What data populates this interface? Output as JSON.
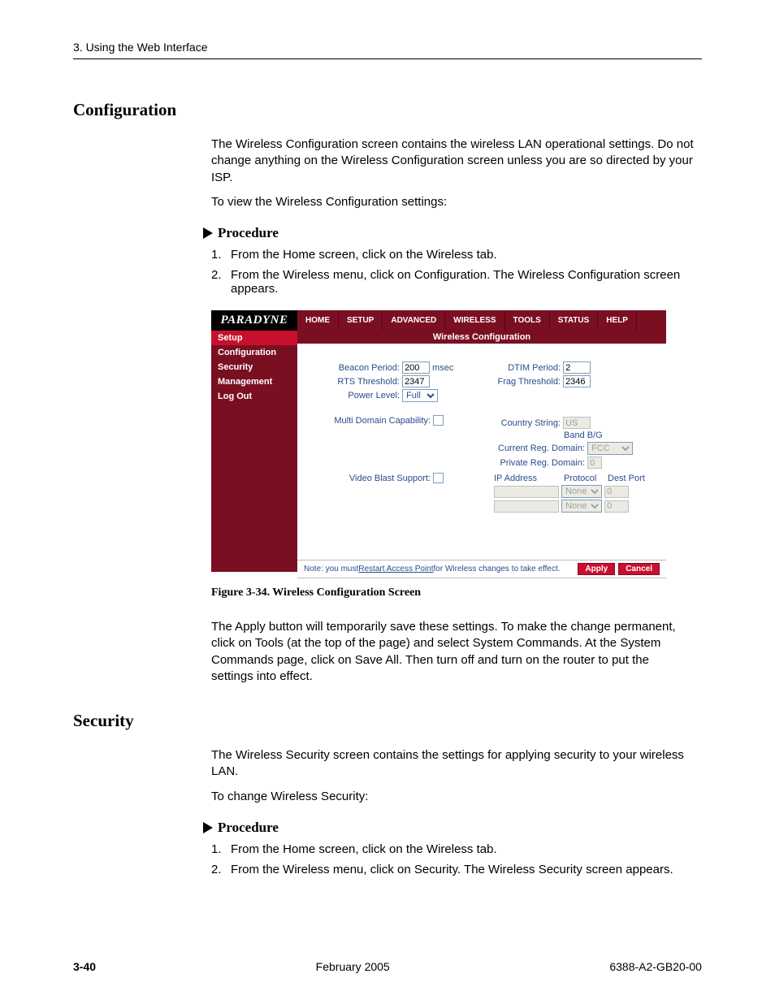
{
  "run_head": "3. Using the Web Interface",
  "h_config": "Configuration",
  "p1": "The Wireless Configuration screen contains the wireless LAN operational settings. Do not change anything on the Wireless Configuration screen unless you are so directed by your ISP.",
  "p2": "To view the Wireless Configuration settings:",
  "proc": "Procedure",
  "cfg_steps": [
    "From the Home screen, click on the Wireless tab.",
    "From the Wireless menu, click on Configuration. The Wireless Configuration screen appears."
  ],
  "figcap": "Figure 3-34.   Wireless Configuration Screen",
  "p3": "The Apply button will temporarily save these settings. To make the change permanent, click on Tools (at the top of the page) and select System Commands. At the System Commands page, click on Save All. Then turn off and turn on the router to put the settings into effect.",
  "h_sec": "Security",
  "p4": "The Wireless Security screen contains the settings for applying security to your wireless LAN.",
  "p5": "To change Wireless Security:",
  "sec_steps": [
    "From the Home screen, click on the Wireless tab.",
    "From the Wireless menu, click on Security. The Wireless Security screen appears."
  ],
  "footer": {
    "page": "3-40",
    "date": "February 2005",
    "doc": "6388-A2-GB20-00"
  },
  "shot": {
    "brand": "PARADYNE",
    "tabs": [
      "HOME",
      "SETUP",
      "ADVANCED",
      "WIRELESS",
      "TOOLS",
      "STATUS",
      "HELP"
    ],
    "side_section": "Setup",
    "side_items": [
      "Configuration",
      "Security",
      "Management",
      "Log Out"
    ],
    "title": "Wireless Configuration",
    "labels": {
      "beacon": "Beacon Period:",
      "msec": "msec",
      "dtim": "DTIM Period:",
      "rts": "RTS Threshold:",
      "frag": "Frag Threshold:",
      "power": "Power Level:",
      "multi": "Multi Domain Capability:",
      "country": "Country String:",
      "band": "Band B/G",
      "curreg": "Current Reg. Domain:",
      "privreg": "Private Reg. Domain:",
      "video": "Video Blast Support:",
      "ip": "IP Address",
      "proto": "Protocol",
      "dport": "Dest Port"
    },
    "values": {
      "beacon": "200",
      "dtim": "2",
      "rts": "2347",
      "frag": "2346",
      "power": "Full",
      "country": "US",
      "curreg": "FCC",
      "privreg": "0",
      "proto1": "None",
      "dport1": "0",
      "proto2": "None",
      "dport2": "0"
    },
    "note_pre": "Note: you must ",
    "note_link": "Restart Access Point",
    "note_post": " for Wireless changes to take effect.",
    "btn_apply": "Apply",
    "btn_cancel": "Cancel"
  }
}
